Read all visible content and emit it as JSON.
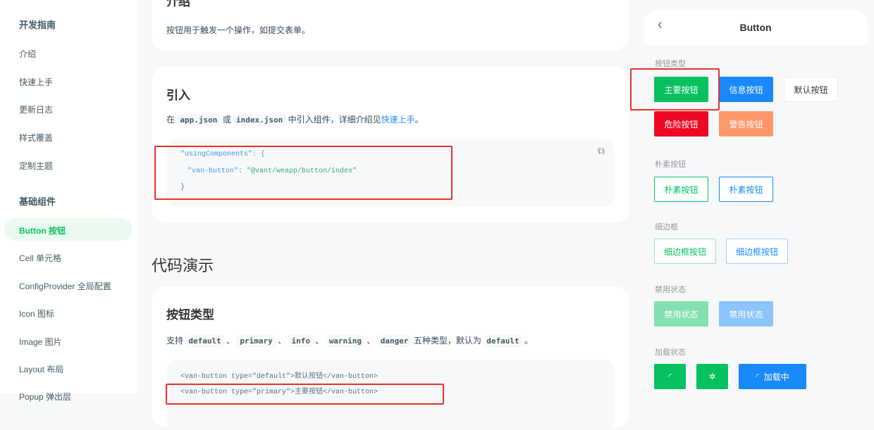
{
  "sidebar": {
    "group1": "开发指南",
    "guide": [
      "介绍",
      "快速上手",
      "更新日志",
      "样式覆盖",
      "定制主题"
    ],
    "group2": "基础组件",
    "active": "Button 按钮",
    "components": [
      "Cell 单元格",
      "ConfigProvider 全局配置",
      "Icon 图标",
      "Image 图片",
      "Layout 布局",
      "Popup 弹出层"
    ]
  },
  "intro": {
    "title": "介绍",
    "text": "按钮用于触发一个操作，如提交表单。"
  },
  "import": {
    "title": "引入",
    "pre": "在",
    "code1": "app.json",
    "or": "或",
    "code2": "index.json",
    "mid": "中引入组件，详细介绍见",
    "link": "快速上手",
    "end": "。",
    "code_lines": [
      "\"usingComponents\": {",
      "\"van-button\"",
      ": ",
      "\"@vant/weapp/button/index\"",
      "}"
    ]
  },
  "demo": {
    "title": "代码演示"
  },
  "types": {
    "title": "按钮类型",
    "pre": "支持",
    "codes": [
      "default",
      "primary",
      "info",
      "warning",
      "danger"
    ],
    "sep": "、",
    "mid": "五种类型，默认为",
    "def": "default",
    "end": "。",
    "code_lines": [
      "<van-button type=\"default\">默认按钮</van-button>",
      "<van-button type=\"primary\">主要按钮</van-button>"
    ]
  },
  "phone": {
    "title": "Button",
    "sections": {
      "types": "按钮类型",
      "plain": "朴素按钮",
      "hairline": "细边框",
      "disabled": "禁用状态",
      "loading": "加载状态"
    },
    "buttons": {
      "primary": "主要按钮",
      "info": "信息按钮",
      "default": "默认按钮",
      "danger": "危险按钮",
      "warning": "警告按钮",
      "plain1": "朴素按钮",
      "plain2": "朴素按钮",
      "hair1": "细边框按钮",
      "hair2": "细边框按钮",
      "dis1": "禁用状态",
      "dis2": "禁用状态",
      "loading": "加载中"
    },
    "colors": {
      "primary": "#07c160",
      "info": "#1989fa",
      "danger": "#ee0a24",
      "warning": "#ff976a"
    }
  }
}
